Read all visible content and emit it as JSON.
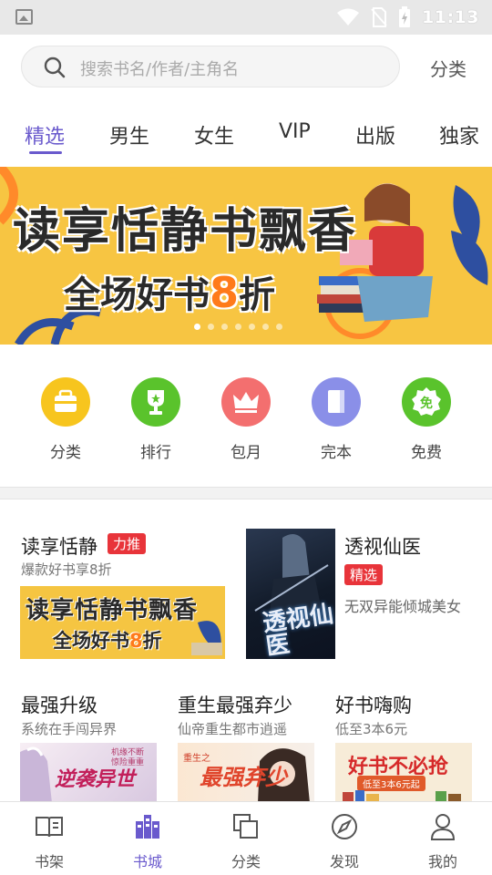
{
  "status_bar": {
    "time": "11:13"
  },
  "search": {
    "placeholder": "搜索书名/作者/主角名",
    "category_label": "分类"
  },
  "tabs": [
    {
      "label": "精选",
      "active": true
    },
    {
      "label": "男生"
    },
    {
      "label": "女生"
    },
    {
      "label": "VIP"
    },
    {
      "label": "出版"
    },
    {
      "label": "独家"
    }
  ],
  "banner": {
    "title": "读享恬静书飘香",
    "subtitle_prefix": "全场好书",
    "subtitle_number": "8",
    "subtitle_suffix": "折",
    "dots": 7,
    "active_dot": 0
  },
  "quick_entries": [
    {
      "label": "分类",
      "color": "#f7c51e",
      "icon": "bag-icon"
    },
    {
      "label": "排行",
      "color": "#5ac32c",
      "icon": "trophy-icon"
    },
    {
      "label": "包月",
      "color": "#f36f6f",
      "icon": "crown-icon"
    },
    {
      "label": "完本",
      "color": "#8a8fe8",
      "icon": "book-icon"
    },
    {
      "label": "免费",
      "color": "#5ac32c",
      "icon": "free-icon"
    }
  ],
  "featured": {
    "left": {
      "title": "读享恬静",
      "badge": "力推",
      "subtitle": "爆款好书享8折",
      "image_title": "读享恬静书飘香",
      "image_sub_prefix": "全场好书",
      "image_sub_number": "8",
      "image_sub_suffix": "折"
    },
    "right": {
      "cover_text": "透视仙医",
      "title": "透视仙医",
      "badge": "精选",
      "subtitle": "无双异能倾城美女"
    }
  },
  "columns": [
    {
      "title": "最强升级",
      "subtitle": "系统在手闯异界",
      "image_text": "逆袭异世",
      "image_tag": "机缘不断 惊险重重"
    },
    {
      "title": "重生最强弃少",
      "subtitle": "仙帝重生都市逍遥",
      "image_text": "最强弃少",
      "image_tag": "重生之"
    },
    {
      "title": "好书嗨购",
      "subtitle": "低至3本6元",
      "image_text": "好书不必抢",
      "image_tag": "低至3本6元起"
    }
  ],
  "bottom_nav": [
    {
      "label": "书架",
      "icon": "bookshelf-icon"
    },
    {
      "label": "书城",
      "icon": "bookstore-icon",
      "active": true
    },
    {
      "label": "分类",
      "icon": "category-icon"
    },
    {
      "label": "发现",
      "icon": "compass-icon"
    },
    {
      "label": "我的",
      "icon": "profile-icon"
    }
  ],
  "colors": {
    "accent": "#6a5acd",
    "badge_red": "#e8343a",
    "banner_yellow": "#f7c542"
  }
}
